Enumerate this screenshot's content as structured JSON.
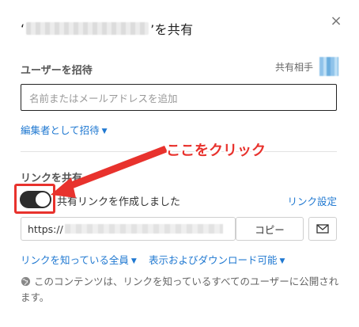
{
  "dialog": {
    "title_prefix": "‘",
    "title_suffix": "’を共有",
    "close_icon": "×"
  },
  "invite": {
    "label": "ユーザーを招待",
    "shared_with_label": "共有相手",
    "input_placeholder": "名前またはメールアドレスを追加",
    "role_link": "編集者として招待"
  },
  "share_link": {
    "label": "リンクを共有",
    "toggle_state": "on",
    "toggle_text": "共有リンクを作成しました",
    "settings_link": "リンク設定",
    "url_prefix": "https://",
    "copy_label": "コピー",
    "audience_link": "リンクを知っている全員",
    "permission_link": "表示およびダウンロード可能",
    "info_text": "このコンテンツは、リンクを知っているすべてのユーザーに公開されます。"
  },
  "annotation": {
    "text": "ここをクリック",
    "color": "#e8322d"
  },
  "colors": {
    "link": "#1f78d1",
    "toggle_on": "#2d2d2d",
    "highlight": "#e8322d"
  },
  "icons": {
    "close": "close-icon",
    "caret": "chevron-down-icon",
    "email": "envelope-icon",
    "globe": "globe-icon"
  }
}
